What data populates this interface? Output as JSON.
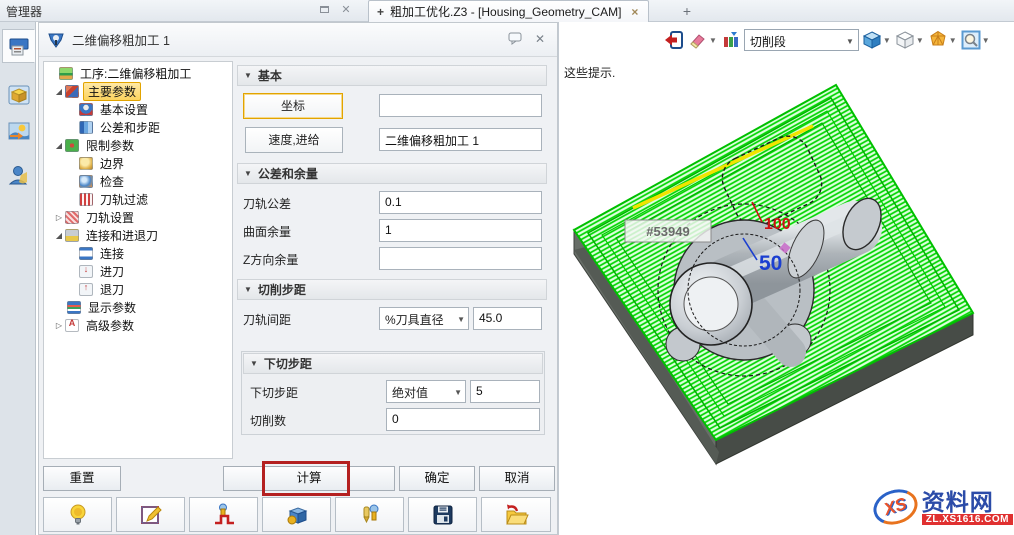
{
  "chrome": {
    "panel_title": "管理器",
    "tab": {
      "modified_plus": "+",
      "title": "粗加工优化.Z3 - [Housing_Geometry_CAM]",
      "close": "×",
      "new_tab": "+"
    }
  },
  "dialog": {
    "title": "二维偏移粗加工 1",
    "tree": {
      "items": [
        {
          "label": "工序:二维偏移粗加工"
        },
        {
          "label": "主要参数"
        },
        {
          "label": "基本设置"
        },
        {
          "label": "公差和步距"
        },
        {
          "label": "限制参数"
        },
        {
          "label": "边界"
        },
        {
          "label": "检查"
        },
        {
          "label": "刀轨过滤"
        },
        {
          "label": "刀轨设置"
        },
        {
          "label": "连接和进退刀"
        },
        {
          "label": "连接"
        },
        {
          "label": "进刀"
        },
        {
          "label": "退刀"
        },
        {
          "label": "显示参数"
        },
        {
          "label": "高级参数"
        }
      ]
    },
    "basic": {
      "title": "基本",
      "coord_button": "坐标",
      "coord_value": "",
      "feed_button": "速度,进给",
      "name_value": "二维偏移粗加工 1"
    },
    "tolerance": {
      "title": "公差和余量",
      "path_tol_label": "刀轨公差",
      "path_tol_value": "0.1",
      "surf_label": "曲面余量",
      "surf_value": "1",
      "z_label": "Z方向余量",
      "z_value": ""
    },
    "step": {
      "title": "切削步距",
      "spacing_label": "刀轨间距",
      "spacing_mode": "%刀具直径",
      "spacing_value": "45.0",
      "sub_title": "下切步距",
      "down_label": "下切步距",
      "down_mode": "绝对值",
      "down_value": "5",
      "cuts_label": "切削数",
      "cuts_value": "0"
    },
    "buttons": {
      "reset": "重置",
      "calculate": "计算",
      "ok": "确定",
      "cancel": "取消"
    }
  },
  "viewport": {
    "hint": "这些提示.",
    "toolbar": {
      "display_mode": "切削段"
    },
    "scene": {
      "tooltip_label": "#53949",
      "dim_red": "100",
      "dim_blue": "50"
    }
  },
  "watermark": {
    "logo_text": "XS",
    "site_name": "资料网",
    "site_url": "ZL.XS1616.COM"
  },
  "colors": {
    "toolpath_green": "#00d400",
    "highlight_yellow": "#f0e400",
    "selection_orange": "#e2a400",
    "annotation_red": "#b42020"
  }
}
